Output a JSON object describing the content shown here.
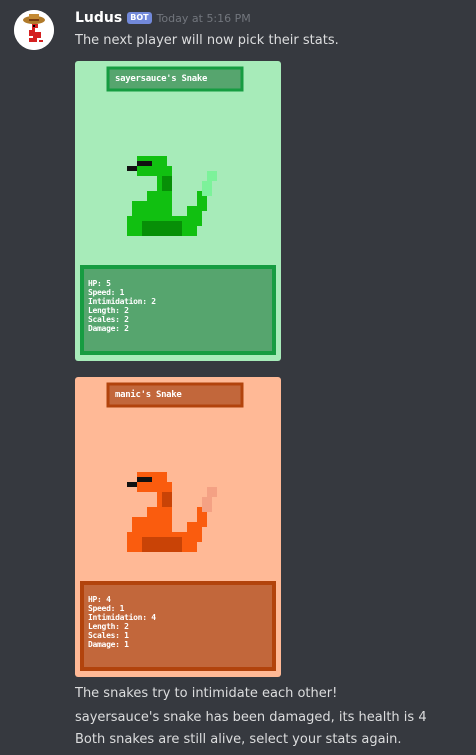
{
  "message": {
    "author": "Ludus",
    "bot_tag": "BOT",
    "timestamp": "Today at 5:16 PM",
    "intro": "The next player will now pick their stats."
  },
  "cards": [
    {
      "title": "sayersauce's Snake",
      "stats": [
        "HP: 5",
        "Speed: 1",
        "Intimidation: 2",
        "Length: 2",
        "Scales: 2",
        "Damage: 2"
      ],
      "colors": {
        "background": "#a7ebb9",
        "panel": "#56a56e",
        "border": "#169c41",
        "snake": "#11c011",
        "snake_dark": "#078f07",
        "tail": "#7cf29a"
      }
    },
    {
      "title": "manic's Snake",
      "stats": [
        "HP: 4",
        "Speed: 1",
        "Intimidation: 4",
        "Length: 2",
        "Scales: 1",
        "Damage: 1"
      ],
      "colors": {
        "background": "#ffb996",
        "panel": "#c2673b",
        "border": "#b2430c",
        "snake": "#fa5c0e",
        "snake_dark": "#c94306",
        "tail": "#f4a184"
      }
    }
  ],
  "result_lines": [
    "The snakes try to intimidate each other!",
    "sayersauce's snake has been damaged, its health is 4",
    "Both snakes are still alive, select your stats again."
  ]
}
